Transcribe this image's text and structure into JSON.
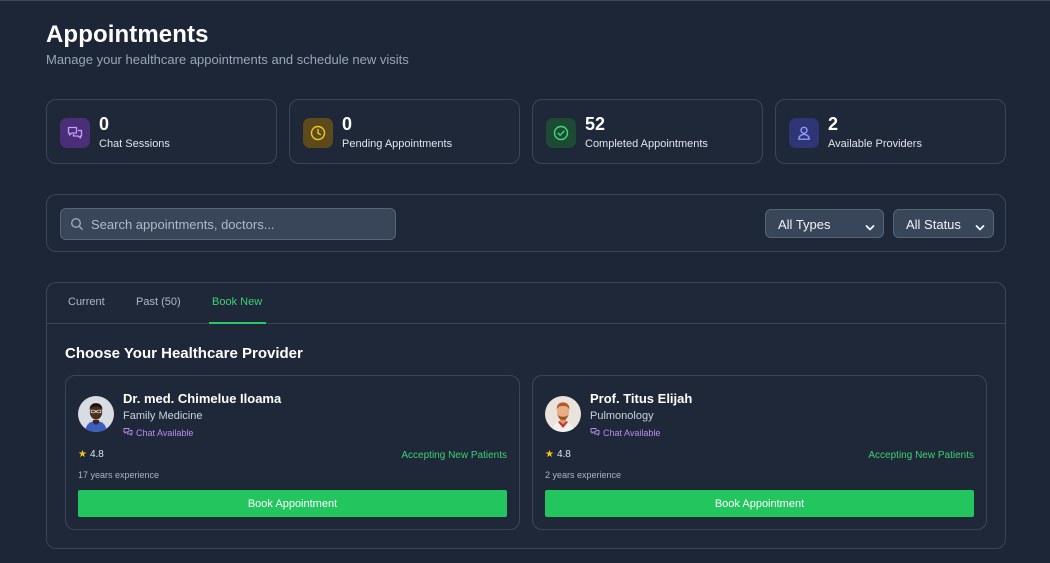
{
  "header": {
    "title": "Appointments",
    "subtitle": "Manage your healthcare appointments and schedule new visits"
  },
  "stats": [
    {
      "value": "0",
      "label": "Chat Sessions",
      "icon": "chat-icon",
      "color": "#a566ff"
    },
    {
      "value": "0",
      "label": "Pending Appointments",
      "icon": "clock-icon",
      "color": "#e6b619"
    },
    {
      "value": "52",
      "label": "Completed Appointments",
      "icon": "check-circle-icon",
      "color": "#2fc968"
    },
    {
      "value": "2",
      "label": "Available Providers",
      "icon": "user-icon",
      "color": "#7c86ff"
    }
  ],
  "filters": {
    "search_placeholder": "Search appointments, doctors...",
    "type_select": "All Types",
    "status_select": "All Status"
  },
  "tabs": [
    {
      "label": "Current",
      "active": false
    },
    {
      "label": "Past (50)",
      "active": false
    },
    {
      "label": "Book New",
      "active": true
    }
  ],
  "section_title": "Choose Your Healthcare Provider",
  "providers": [
    {
      "name": "Dr. med. Chimelue Iloama",
      "specialty": "Family Medicine",
      "chat": "Chat Available",
      "rating": "4.8",
      "status": "Accepting New Patients",
      "experience": "17 years experience",
      "button": "Book Appointment"
    },
    {
      "name": "Prof. Titus Elijah",
      "specialty": "Pulmonology",
      "chat": "Chat Available",
      "rating": "4.8",
      "status": "Accepting New Patients",
      "experience": "2 years experience",
      "button": "Book Appointment"
    }
  ],
  "colors": {
    "background": "#1c2637",
    "card_border": "#39465a",
    "accent_green": "#22c55e",
    "chat_purple": "#b98bf2"
  }
}
